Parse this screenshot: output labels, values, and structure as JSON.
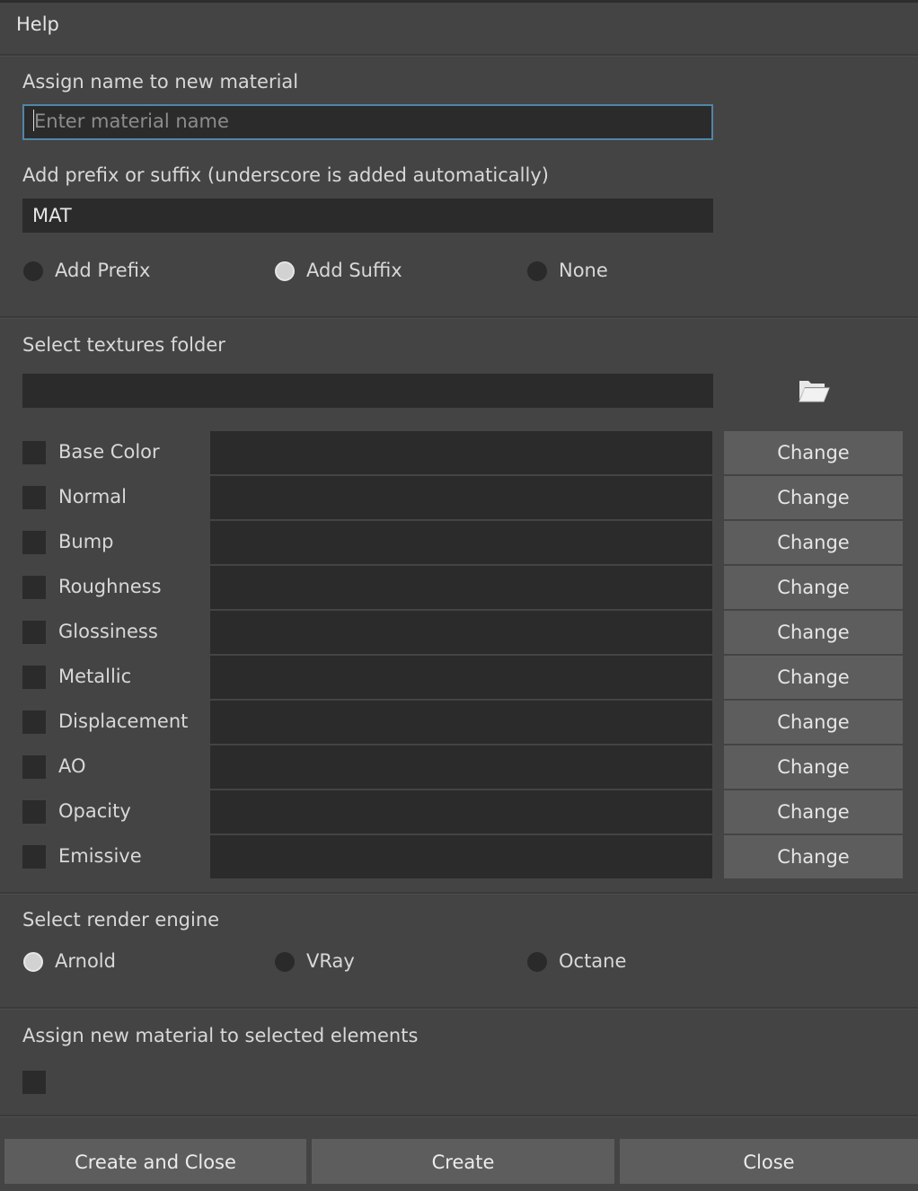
{
  "menu": {
    "help_label": "Help"
  },
  "name_section": {
    "label": "Assign name to new material",
    "placeholder": "Enter material name",
    "value": ""
  },
  "affix_section": {
    "label": "Add prefix or suffix (underscore is added automatically)",
    "value": "MAT",
    "options": [
      {
        "label": "Add Prefix",
        "selected": false
      },
      {
        "label": "Add Suffix",
        "selected": true
      },
      {
        "label": "None",
        "selected": false
      }
    ]
  },
  "textures_section": {
    "label": "Select textures folder",
    "folder_path": "",
    "folder_icon": "folder-open-icon",
    "change_label": "Change",
    "maps": [
      {
        "label": "Base Color",
        "checked": false,
        "path": ""
      },
      {
        "label": "Normal",
        "checked": false,
        "path": ""
      },
      {
        "label": "Bump",
        "checked": false,
        "path": ""
      },
      {
        "label": "Roughness",
        "checked": false,
        "path": ""
      },
      {
        "label": "Glossiness",
        "checked": false,
        "path": ""
      },
      {
        "label": "Metallic",
        "checked": false,
        "path": ""
      },
      {
        "label": "Displacement",
        "checked": false,
        "path": ""
      },
      {
        "label": "AO",
        "checked": false,
        "path": ""
      },
      {
        "label": "Opacity",
        "checked": false,
        "path": ""
      },
      {
        "label": "Emissive",
        "checked": false,
        "path": ""
      }
    ]
  },
  "render_section": {
    "label": "Select render engine",
    "options": [
      {
        "label": "Arnold",
        "selected": true
      },
      {
        "label": "VRay",
        "selected": false
      },
      {
        "label": "Octane",
        "selected": false
      }
    ]
  },
  "assign_section": {
    "label": "Assign new material to selected elements",
    "checked": false
  },
  "footer": {
    "create_close_label": "Create and Close",
    "create_label": "Create",
    "close_label": "Close"
  },
  "colors": {
    "background": "#444444",
    "field": "#2b2b2b",
    "button": "#5d5d5d",
    "focus_border": "#5285a6"
  }
}
